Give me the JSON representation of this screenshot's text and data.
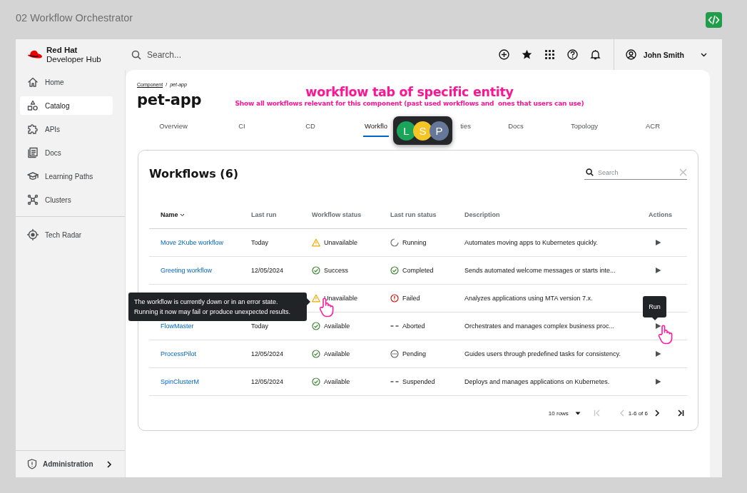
{
  "canvas": {
    "title": "02 Workflow Orchestrator"
  },
  "topbar": {
    "brand_top": "Red Hat",
    "brand_bottom": "Developer Hub",
    "search_placeholder": "Search...",
    "user": "John Smith"
  },
  "sidebar": {
    "sections": [
      {
        "items": [
          {
            "label": "Home",
            "selected": false
          },
          {
            "label": "Catalog",
            "selected": true
          },
          {
            "label": "APIs",
            "selected": false
          },
          {
            "label": "Docs",
            "selected": false
          },
          {
            "label": "Learning Paths",
            "selected": false
          },
          {
            "label": "Clusters",
            "selected": false
          }
        ]
      },
      {
        "items": [
          {
            "label": "Tech Radar",
            "selected": false
          }
        ]
      }
    ],
    "footer": "Administration"
  },
  "entity": {
    "breadcrumb": {
      "parent": "Component",
      "separator": "/",
      "current": "pet-app"
    },
    "title": "pet-app",
    "annotation": {
      "heading": "workflow tab of specific entity",
      "note": "Show all workflows relevant for this component (past used workflows and  ones that users can use)"
    },
    "tabs": [
      {
        "label": "Overview",
        "selected": false
      },
      {
        "label": "CI",
        "selected": false
      },
      {
        "label": "CD",
        "selected": false
      },
      {
        "label": "Workflo",
        "selected": true
      },
      {
        "label": "ties",
        "selected": false
      },
      {
        "label": "Docs",
        "selected": false
      },
      {
        "label": "Topology",
        "selected": false
      },
      {
        "label": "ACR",
        "selected": false
      }
    ],
    "presence": [
      {
        "initial": "L",
        "color": "#1aa55a"
      },
      {
        "initial": "S",
        "color": "#f5c526"
      },
      {
        "initial": "P",
        "color": "#66789a"
      }
    ]
  },
  "workflows": {
    "title": "Workflows (6)",
    "search_placeholder": "Search",
    "columns": [
      {
        "label": "Name",
        "sorted": true
      },
      {
        "label": "Last run",
        "sorted": false
      },
      {
        "label": "Workflow status",
        "sorted": false
      },
      {
        "label": "Last run status",
        "sorted": false
      },
      {
        "label": "Description",
        "sorted": false
      },
      {
        "label": "Actions",
        "sorted": false
      }
    ],
    "rows": [
      {
        "name": "Move 2Kube workflow",
        "last_run": "Today",
        "workflow_status": {
          "kind": "warning",
          "label": "Unavailable"
        },
        "last_run_status": {
          "kind": "running",
          "label": "Running"
        },
        "description": "Automates moving apps to Kubernetes quickly.",
        "run_button": true
      },
      {
        "name": "Greeting workflow",
        "last_run": "12/05/2024",
        "workflow_status": {
          "kind": "success",
          "label": "Success"
        },
        "last_run_status": {
          "kind": "success",
          "label": "Completed"
        },
        "description": "Sends automated welcome messages or starts inte...",
        "run_button": true
      },
      {
        "workflow_status": {
          "kind": "warning",
          "label": "Unavailable"
        },
        "last_run_status": {
          "kind": "failed",
          "label": "Failed"
        },
        "description": "Analyzes applications using MTA version 7.x.",
        "run_button": false
      },
      {
        "name": "FlowMaster",
        "last_run": "Today",
        "workflow_status": {
          "kind": "success",
          "label": "Available"
        },
        "last_run_status": {
          "kind": "dashes",
          "label": "Aborted"
        },
        "description": "Orchestrates and manages complex business proc...",
        "run_button": true
      },
      {
        "name": "ProcessPilot",
        "last_run": "12/05/2024",
        "workflow_status": {
          "kind": "success",
          "label": "Available"
        },
        "last_run_status": {
          "kind": "pending",
          "label": "Pending"
        },
        "description": "Guides users through predefined tasks for consistency.",
        "run_button": true
      },
      {
        "name": "SpinClusterM",
        "last_run": "12/05/2024",
        "workflow_status": {
          "kind": "success",
          "label": "Available"
        },
        "last_run_status": {
          "kind": "dashes",
          "label": "Suspended"
        },
        "description": "Deploys and manages applications on Kubernetes.",
        "run_button": true
      }
    ],
    "rows_per_page": "10 rows",
    "range": "1-6 of 6",
    "status_tooltip": "The workflow is currently down or in an error state. Running it now may fail or produce unexpected results.",
    "run_tooltip": "Run"
  }
}
